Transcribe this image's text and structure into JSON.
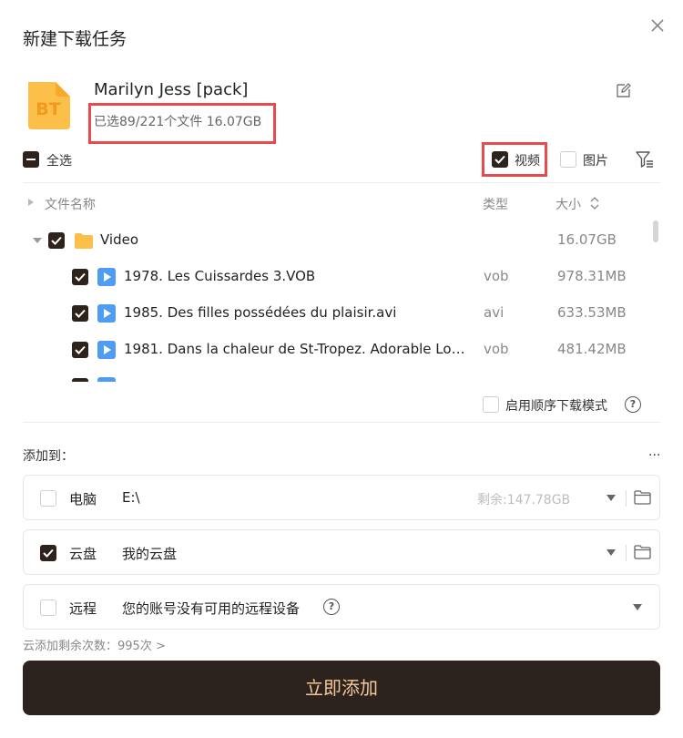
{
  "dialog": {
    "title": "新建下载任务"
  },
  "task": {
    "icon_text": "BT",
    "name": "Marilyn Jess [pack]",
    "summary": "已选89/221个文件 16.07GB"
  },
  "select_all": {
    "label": "全选",
    "state": "partial"
  },
  "filters": {
    "video": {
      "label": "视频",
      "checked": true
    },
    "image": {
      "label": "图片",
      "checked": false
    }
  },
  "columns": {
    "name": "文件名称",
    "type": "类型",
    "size": "大小"
  },
  "folder": {
    "name": "Video",
    "size": "16.07GB",
    "checked": true
  },
  "files": [
    {
      "name": "1978. Les Cuissardes 3.VOB",
      "type": "vob",
      "size": "978.31MB",
      "checked": true
    },
    {
      "name": "1985. Des filles possédées du plaisir.avi",
      "type": "avi",
      "size": "633.53MB",
      "checked": true
    },
    {
      "name": "1981. Dans la chaleur de St-Tropez. Adorable Lola ...",
      "type": "vob",
      "size": "481.42MB",
      "checked": true
    }
  ],
  "sequential": {
    "label": "启用顺序下载模式",
    "checked": false
  },
  "add_to": {
    "label": "添加到：",
    "more": "..."
  },
  "destinations": [
    {
      "name": "电脑",
      "path": "E:\\",
      "remain": "剩余:147.78GB",
      "checked": false,
      "has_folder": true
    },
    {
      "name": "云盘",
      "path": "我的云盘",
      "remain": "",
      "checked": true,
      "has_folder": true
    },
    {
      "name": "远程",
      "path": "您的账号没有可用的远程设备",
      "remain": "",
      "checked": false,
      "has_folder": false
    }
  ],
  "quota": "云添加剩余次数：995次 >",
  "submit_label": "立即添加",
  "colors": {
    "accent_dark": "#2d231e",
    "button_text": "#f4c79a",
    "highlight": "#e84b4b",
    "folder": "#fcc04a",
    "file": "#4f9cf5"
  },
  "icons": [
    "close-icon",
    "edit-icon",
    "filter-icon",
    "sort-icon",
    "folder-icon",
    "file-video-icon",
    "help-icon",
    "chevron-down-icon"
  ]
}
